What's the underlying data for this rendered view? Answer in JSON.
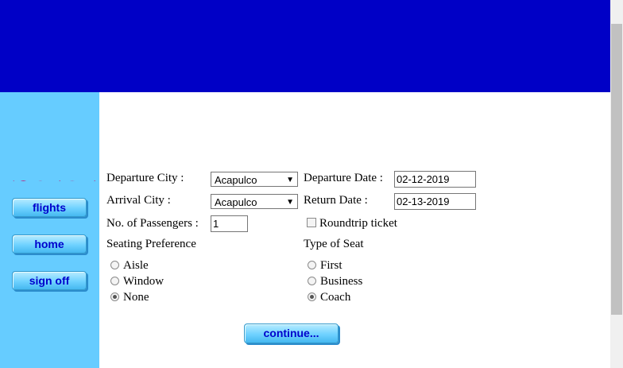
{
  "nav": {
    "flights": "flights",
    "home": "home",
    "sign_off": "sign off"
  },
  "form": {
    "departure_city_label": "Departure City :",
    "departure_city_value": "Acapulco",
    "departure_date_label": "Departure Date :",
    "departure_date_value": "02-12-2019",
    "arrival_city_label": "Arrival City :",
    "arrival_city_value": "Acapulco",
    "return_date_label": "Return Date :",
    "return_date_value": "02-13-2019",
    "passengers_label": "No. of Passengers :",
    "passengers_value": "1",
    "roundtrip_label": "Roundtrip ticket",
    "roundtrip_checked": false,
    "seating_pref_label": "Seating Preference",
    "seating_options": [
      "Aisle",
      "Window",
      "None"
    ],
    "seating_selected": "None",
    "seat_type_label": "Type of Seat",
    "seat_type_options": [
      "First",
      "Business",
      "Coach"
    ],
    "seat_type_selected": "Coach",
    "continue_label": "continue..."
  },
  "colors": {
    "header_bg": "#0000c6",
    "sidebar_bg": "#66ccff",
    "button_text": "#0000cc"
  }
}
